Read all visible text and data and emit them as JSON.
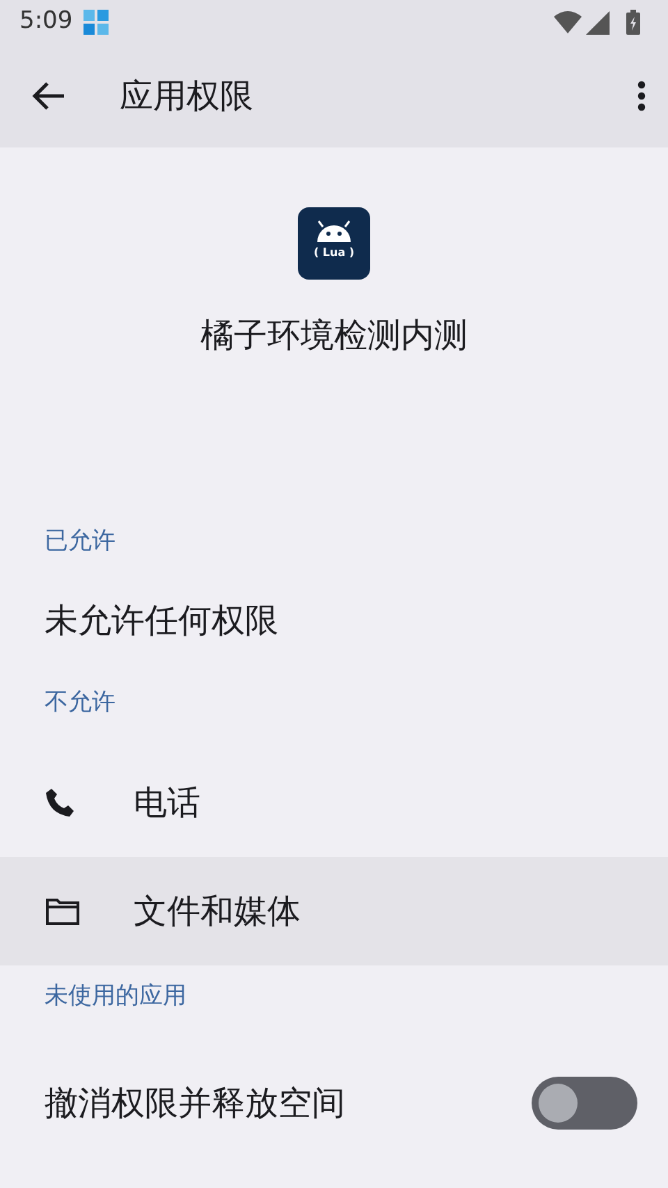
{
  "status_bar": {
    "time": "5:09"
  },
  "toolbar": {
    "title": "应用权限"
  },
  "app": {
    "icon_label": "( Lua )",
    "name": "橘子环境检测内测"
  },
  "sections": [
    {
      "header": "已允许",
      "items": [
        {
          "kind": "text",
          "label": "未允许任何权限"
        }
      ]
    },
    {
      "header": "不允许",
      "items": [
        {
          "kind": "phone",
          "label": "电话",
          "selected": false
        },
        {
          "kind": "folder",
          "label": "文件和媒体",
          "selected": true
        }
      ]
    },
    {
      "header": "未使用的应用",
      "items": [
        {
          "kind": "switch",
          "label": "撤消权限并释放空间",
          "on": false
        }
      ]
    }
  ]
}
